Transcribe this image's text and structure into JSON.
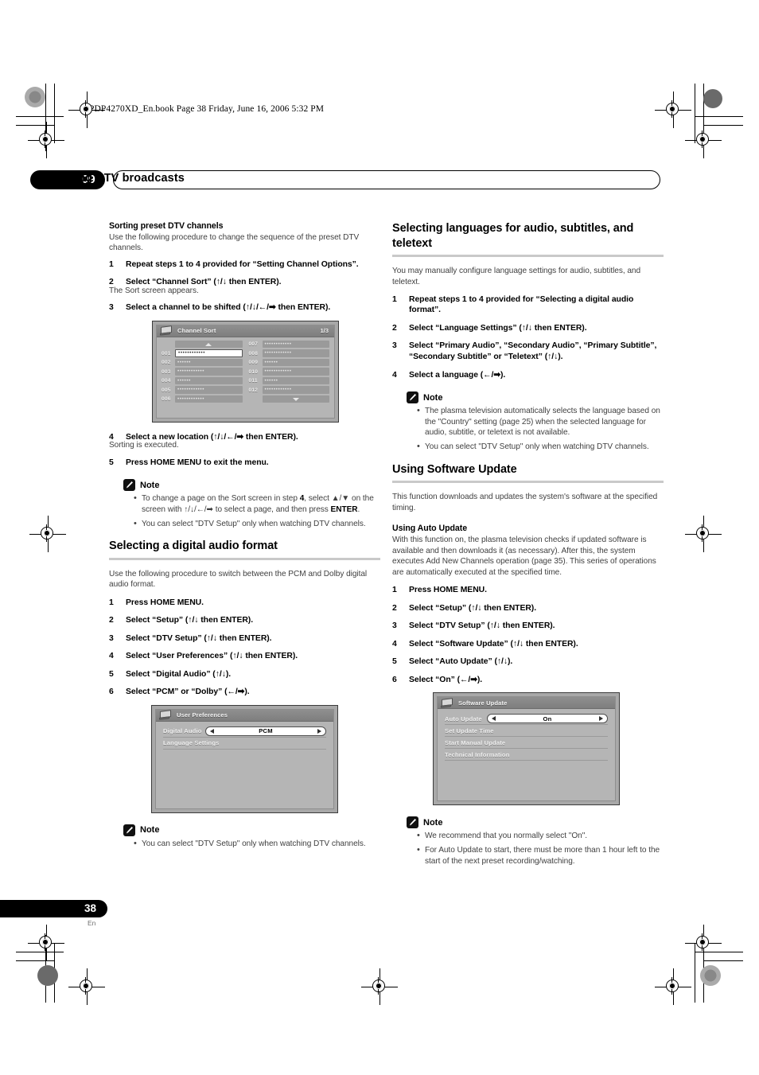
{
  "book_header": "PDP4270XD_En.book  Page 38  Friday, June 16, 2006  5:32 PM",
  "chapter": {
    "number": "09",
    "title": "Enjoying DTV broadcasts"
  },
  "footer": {
    "page_number": "38",
    "language": "En"
  },
  "left_column": {
    "section1": {
      "heading": "Sorting preset DTV channels",
      "intro": "Use the following procedure to change the sequence of the preset DTV channels.",
      "steps": [
        {
          "n": "1",
          "text": "Repeat steps 1 to 4 provided for “Setting Channel Options”."
        },
        {
          "n": "2",
          "text": "Select “Channel Sort” (↑/↓ then ENTER).",
          "caption": "The Sort screen appears."
        },
        {
          "n": "3",
          "text": "Select a channel to be shifted (↑/↓/←/➡ then ENTER)."
        }
      ],
      "steps_after": [
        {
          "n": "4",
          "text": "Select a new location (↑/↓/←/➡ then ENTER).",
          "caption": "Sorting is executed."
        },
        {
          "n": "5",
          "text": "Press HOME MENU to exit the menu."
        }
      ],
      "note": {
        "title": "Note",
        "items": [
          "To change a page on the Sort screen in step 4, select ▲/▼ on the screen with ↑/↓/←/➡ to select a page, and then press ENTER.",
          "You can select \"DTV Setup\" only when watching DTV channels."
        ]
      }
    },
    "section2": {
      "heading": "Selecting a digital audio format",
      "intro": "Use the following procedure to switch between the PCM and Dolby digital audio format.",
      "steps": [
        {
          "n": "1",
          "text": "Press HOME MENU."
        },
        {
          "n": "2",
          "text": "Select “Setup” (↑/↓ then ENTER)."
        },
        {
          "n": "3",
          "text": "Select “DTV Setup” (↑/↓ then ENTER)."
        },
        {
          "n": "4",
          "text": "Select “User Preferences” (↑/↓ then ENTER)."
        },
        {
          "n": "5",
          "text": "Select “Digital Audio” (↑/↓)."
        },
        {
          "n": "6",
          "text": "Select “PCM” or “Dolby” (←/➡)."
        }
      ],
      "note": {
        "title": "Note",
        "items": [
          "You can select \"DTV Setup\" only when watching DTV channels."
        ]
      }
    }
  },
  "right_column": {
    "section1": {
      "heading": "Selecting languages for audio, subtitles, and teletext",
      "intro": "You may manually configure language settings for audio, subtitles, and teletext.",
      "steps": [
        {
          "n": "1",
          "text": "Repeat steps 1 to 4 provided for “Selecting a digital audio format”."
        },
        {
          "n": "2",
          "text": "Select “Language Settings” (↑/↓ then ENTER)."
        },
        {
          "n": "3",
          "text": "Select “Primary Audio”, “Secondary Audio”, “Primary Subtitle”, “Secondary Subtitle” or “Teletext” (↑/↓)."
        },
        {
          "n": "4",
          "text": "Select a language (←/➡)."
        }
      ],
      "note": {
        "title": "Note",
        "items": [
          "The plasma television automatically selects the language based on the \"Country\" setting (page 25) when the selected language for audio, subtitle, or teletext is not available.",
          "You can select \"DTV Setup\" only when watching DTV channels."
        ]
      }
    },
    "section2": {
      "heading": "Using Software Update",
      "intro": "This function downloads and updates the system's software at the specified timing.",
      "subheading": "Using Auto Update",
      "sub_intro": "With this function on, the plasma television checks if updated software is available and then downloads it (as necessary). After this, the system executes Add New Channels operation (page 35). This series of operations are automatically executed at the specified time.",
      "steps": [
        {
          "n": "1",
          "text": "Press HOME MENU."
        },
        {
          "n": "2",
          "text": "Select “Setup” (↑/↓ then ENTER)."
        },
        {
          "n": "3",
          "text": "Select “DTV Setup” (↑/↓ then ENTER)."
        },
        {
          "n": "4",
          "text": "Select “Software Update” (↑/↓ then ENTER)."
        },
        {
          "n": "5",
          "text": "Select “Auto Update” (↑/↓)."
        },
        {
          "n": "6",
          "text": "Select “On” (←/➡)."
        }
      ],
      "note": {
        "title": "Note",
        "items": [
          "We recommend that you normally select \"On\".",
          "For Auto Update to start, there must be more than 1 hour left to the start of the next preset recording/watching."
        ]
      }
    }
  },
  "osd_channel_sort": {
    "title": "Channel Sort",
    "page_indicator": "1/3",
    "left_entries": [
      {
        "num": "001",
        "dots": "••••••••••••",
        "selected": true
      },
      {
        "num": "002",
        "dots": "••••••",
        "selected": false
      },
      {
        "num": "003",
        "dots": "••••••••••••",
        "selected": false
      },
      {
        "num": "004",
        "dots": "••••••",
        "selected": false
      },
      {
        "num": "005",
        "dots": "••••••••••••",
        "selected": false
      },
      {
        "num": "006",
        "dots": "••••••••••••",
        "selected": false
      }
    ],
    "right_entries": [
      {
        "num": "007",
        "dots": "••••••••••••",
        "selected": false
      },
      {
        "num": "008",
        "dots": "••••••••••••",
        "selected": false
      },
      {
        "num": "009",
        "dots": "••••••",
        "selected": false
      },
      {
        "num": "010",
        "dots": "••••••••••••",
        "selected": false
      },
      {
        "num": "011",
        "dots": "••••••",
        "selected": false
      },
      {
        "num": "012",
        "dots": "••••••••••••",
        "selected": false
      }
    ]
  },
  "osd_user_preferences": {
    "title": "User Preferences",
    "rows": [
      {
        "label": "Digital Audio",
        "value": "PCM"
      },
      {
        "label": "Language Settings",
        "value": ""
      }
    ]
  },
  "osd_software_update": {
    "title": "Software Update",
    "rows": [
      {
        "label": "Auto Update",
        "value": "On"
      },
      {
        "label": "Set Update Time",
        "value": ""
      },
      {
        "label": "Start Manual Update",
        "value": ""
      },
      {
        "label": "Technical Information",
        "value": ""
      }
    ]
  }
}
